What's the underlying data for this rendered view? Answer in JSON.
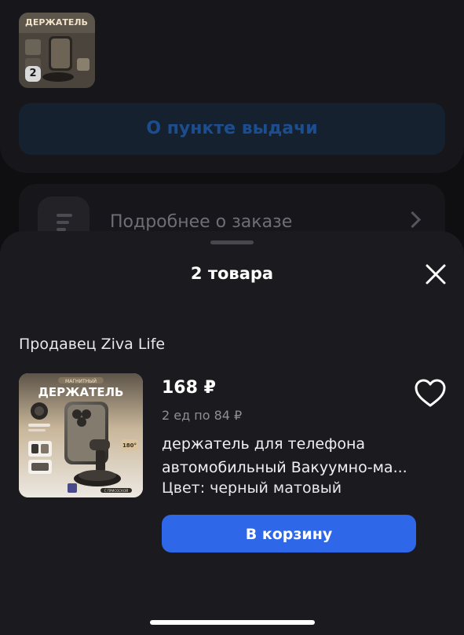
{
  "background": {
    "thumbnail_count": "2",
    "pickup_button_label": "О пункте выдачи",
    "order_details_label": "Подробнее о заказе"
  },
  "sheet": {
    "title": "2 товара",
    "close_icon": "close-icon",
    "seller_label": "Продавец Ziva Life",
    "product": {
      "image_text": {
        "top": "МАГНИТНЫЙ",
        "main": "ДЕРЖАТЕЛЬ",
        "badge": "180°",
        "bottom": "С ПРИСОСКОЙ"
      },
      "price": "168 ₽",
      "unit_price": "2 ед по 84 ₽",
      "title_line1": "держатель для телефона",
      "title_line2": "автомобильный Вакуумно-ма...",
      "color": "Цвет: черный матовый",
      "favorite_icon": "heart-icon",
      "add_to_cart_label": "В корзину"
    }
  },
  "colors": {
    "accent": "#2e67e8",
    "sheet_bg": "#1b1b1f",
    "page_bg": "#0f0f11"
  }
}
